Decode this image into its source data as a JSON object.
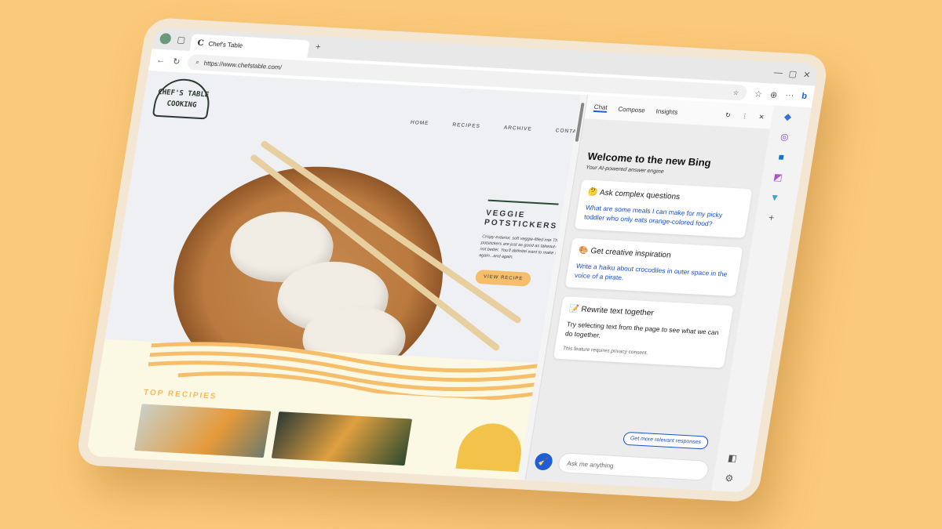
{
  "browser": {
    "tab_title": "Chef's Table",
    "tab_favicon": "C",
    "url": "https://www.chefstable.com/"
  },
  "site": {
    "logo": "CHEF'S TABLE COOKING",
    "nav": [
      "HOME",
      "RECIPES",
      "ARCHIVE",
      "CONTAC"
    ],
    "hero": {
      "title": "VEGGIE POTSTICKERS",
      "description": "Crispy exterior, soft veggie-filled inte These potstickers are just as good as takeout—if not better. You'll definitel want to make them again...and again.",
      "button": "VIEW RECIPE"
    },
    "section_title": "TOP RECIPIES"
  },
  "bing": {
    "tabs": [
      "Chat",
      "Compose",
      "Insights"
    ],
    "title": "Welcome to the new Bing",
    "subtitle": "Your AI-powered answer engine",
    "cards": [
      {
        "title": "Ask complex questions",
        "text": "What are some meals I can make for my picky toddler who only eats orange-colored food?",
        "emoji": "🤔"
      },
      {
        "title": "Get creative inspiration",
        "text": "Write a haiku about crocodiles in outer space in the voice of a pirate.",
        "emoji": "🎨"
      },
      {
        "title": "Rewrite text together",
        "text": "Try selecting text from the page to see what we can do together.",
        "note": "This feature requires privacy consent.",
        "emoji": "📝"
      }
    ],
    "more_button": "Get more relevant responses",
    "ask_placeholder": "Ask me anything"
  },
  "colors": {
    "background": "#fbc97a",
    "accent": "#1e5ed6",
    "recipe_button": "#f6bd6a"
  }
}
